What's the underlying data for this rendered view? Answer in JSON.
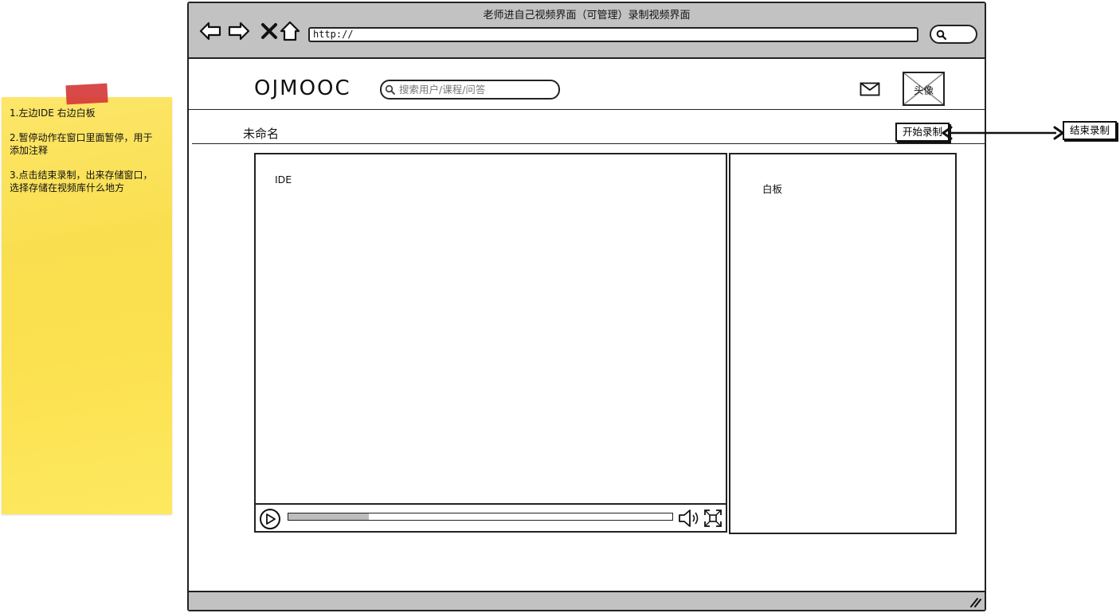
{
  "note": {
    "lines": [
      "1.左边IDE 右边白板",
      "2.暂停动作在窗口里面暂停，用于",
      "添加注释",
      "3.点击结束录制，出来存储窗口，",
      "选择存储在视频库什么地方"
    ]
  },
  "browser": {
    "title": "老师进自己视频界面（可管理）录制视频界面",
    "url": "http://"
  },
  "header": {
    "logo": "OJMOOC",
    "search_placeholder": "搜索用户/课程/问答",
    "avatar_label": "头像"
  },
  "toolbar": {
    "video_title": "未命名",
    "start_record_label": "开始录制",
    "end_record_label": "结束录制"
  },
  "panels": {
    "ide_label": "IDE",
    "whiteboard_label": "白板"
  },
  "player": {
    "progress_fraction": 0.21
  },
  "icons": {
    "back": "back-arrow-icon",
    "forward": "forward-arrow-icon",
    "stop": "close-icon",
    "home": "home-icon",
    "browser_search": "search-icon",
    "mail": "mail-icon",
    "play": "play-icon",
    "volume": "volume-icon",
    "fullscreen": "fullscreen-icon"
  },
  "colors": {
    "chrome_gray": "#c2c2c2",
    "note_yellow": "#fbe14f",
    "tape_red": "#d63a3a",
    "progress_gray": "#bdbdbd"
  }
}
